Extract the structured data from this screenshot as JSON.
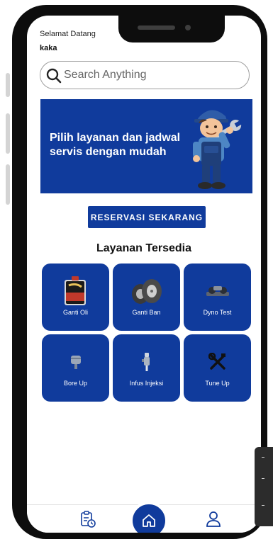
{
  "header": {
    "greeting": "Selamat Datang",
    "username": "kaka"
  },
  "search": {
    "placeholder": "Search Anything",
    "icon": "search-icon"
  },
  "banner": {
    "text": "Pilih layanan dan jadwal servis dengan mudah",
    "image": "mechanic-illustration"
  },
  "reserve_button": {
    "label": "RESERVASI SEKARANG"
  },
  "services": {
    "title": "Layanan Tersedia",
    "items": [
      {
        "label": "Ganti Oli",
        "icon": "oil-can-icon"
      },
      {
        "label": "Ganti Ban",
        "icon": "tire-icon"
      },
      {
        "label": "Dyno Test",
        "icon": "dyno-icon"
      },
      {
        "label": "Bore Up",
        "icon": "piston-icon"
      },
      {
        "label": "Infus Injeksi",
        "icon": "injector-icon"
      },
      {
        "label": "Tune Up",
        "icon": "tools-icon"
      }
    ]
  },
  "bottom_nav": {
    "items": [
      {
        "name": "history",
        "icon": "clipboard-clock-icon"
      },
      {
        "name": "home",
        "icon": "home-icon"
      },
      {
        "name": "profile",
        "icon": "user-icon"
      }
    ]
  },
  "colors": {
    "primary": "#103b9c",
    "frame": "#0d0d0d",
    "background": "#ffffff"
  }
}
